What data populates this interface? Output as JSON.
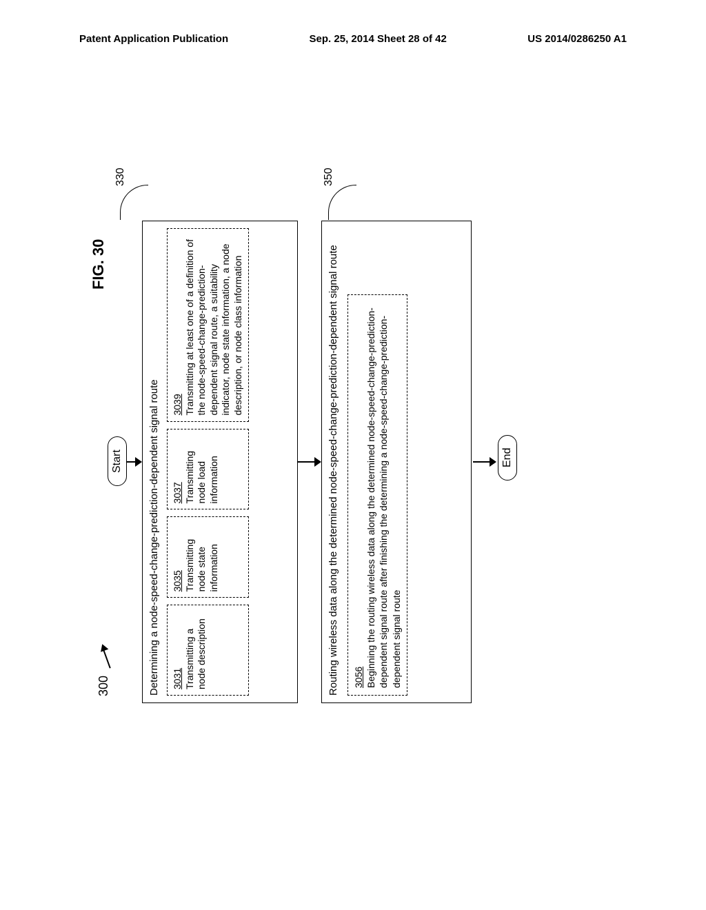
{
  "header": {
    "left": "Patent Application Publication",
    "mid": "Sep. 25, 2014  Sheet 28 of 42",
    "right": "US 2014/0286250 A1"
  },
  "figure_label": "FIG. 30",
  "ref300": "300",
  "start_label": "Start",
  "end_label": "End",
  "block330": {
    "ref": "330",
    "title": "Determining a node-speed-change-prediction-dependent signal route",
    "s3031": {
      "num": "3031",
      "text": "Transmitting a node description"
    },
    "s3035": {
      "num": "3035",
      "text": "Transmitting node state information"
    },
    "s3037": {
      "num": "3037",
      "text": "Transmitting node load information"
    },
    "s3039": {
      "num": "3039",
      "text": "Transmitting at least one of a definition of the node-speed-change-prediction-dependent signal route, a suitability indicator, node state information, a node description, or node class information"
    }
  },
  "block350": {
    "ref": "350",
    "title": "Routing wireless data along the determined node-speed-change-prediction-dependent signal route",
    "s3056": {
      "num": "3056",
      "text": "Beginning the routing wireless data along the determined node-speed-change-prediction-dependent signal route after finishing the determining a node-speed-change-prediction-dependent signal route"
    }
  }
}
